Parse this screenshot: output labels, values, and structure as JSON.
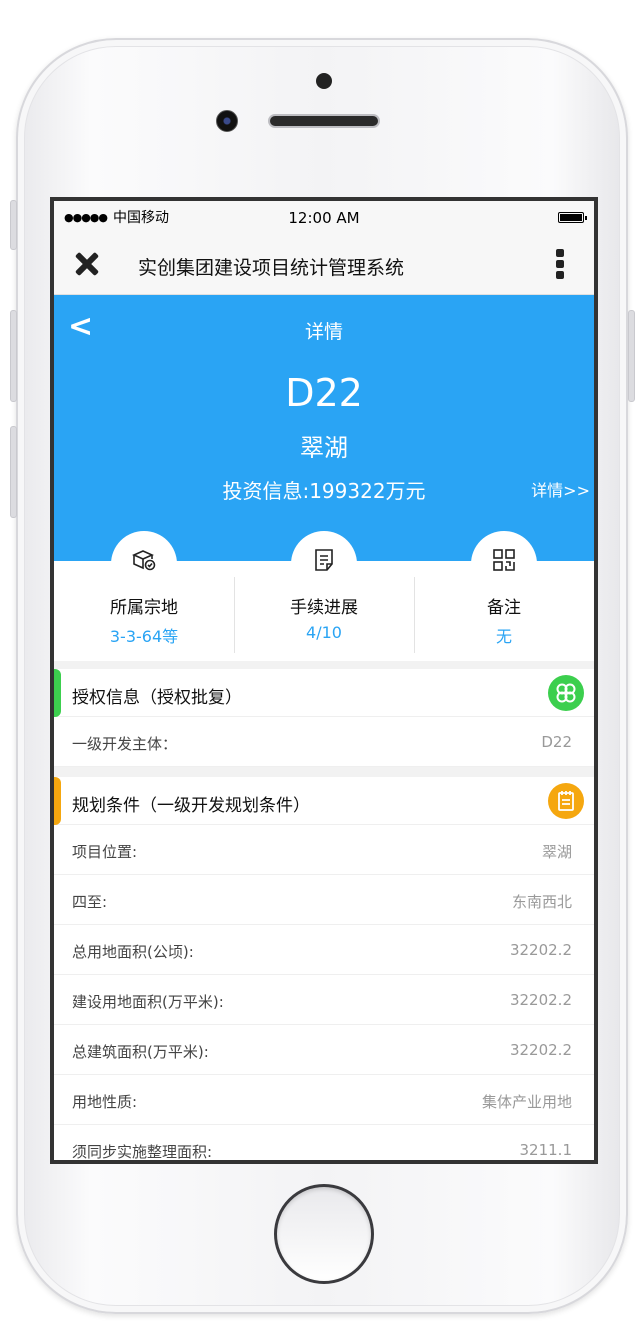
{
  "statusbar": {
    "signal": "●●●●●",
    "carrier": "中国移动",
    "time": "12:00 AM"
  },
  "appbar": {
    "title": "实创集团建设项目统计管理系统"
  },
  "hero": {
    "back": "<",
    "title": "详情",
    "code": "D22",
    "name": "翠湖",
    "invest": "投资信息:199322万元",
    "detail_link": "详情>>"
  },
  "stats": [
    {
      "icon": "package-icon",
      "label": "所属宗地",
      "value": "3-3-64等"
    },
    {
      "icon": "document-icon",
      "label": "手续进展",
      "value": "4/10"
    },
    {
      "icon": "qr-code-icon",
      "label": "备注",
      "value": "无"
    }
  ],
  "sections": {
    "auth": {
      "title": "授权信息（授权批复）",
      "accent": "#3ccf4e",
      "icon": "clover-icon",
      "rows": [
        {
          "label": "一级开发主体：",
          "value": "D22"
        }
      ]
    },
    "plan": {
      "title": "规划条件（一级开发规划条件）",
      "accent": "#f5a70f",
      "icon": "notepad-icon",
      "rows": [
        {
          "label": "项目位置:",
          "value": "翠湖"
        },
        {
          "label": "四至:",
          "value": "东南西北"
        },
        {
          "label": "总用地面积(公顷):",
          "value": "32202.2"
        },
        {
          "label": "建设用地面积(万平米):",
          "value": "32202.2"
        },
        {
          "label": "总建筑面积(万平米):",
          "value": "32202.2"
        },
        {
          "label": "用地性质:",
          "value": "集体产业用地"
        },
        {
          "label": "须同步实施整理面积:",
          "value": "3211.1"
        }
      ]
    }
  },
  "colors": {
    "primary": "#2aa4f4"
  }
}
